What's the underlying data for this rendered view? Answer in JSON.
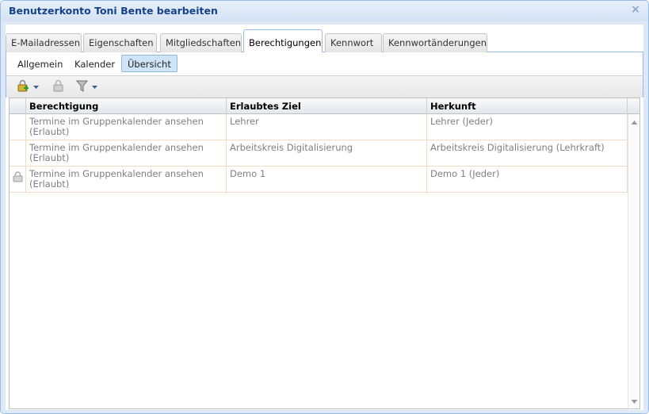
{
  "window": {
    "title": "Benutzerkonto Toni Bente bearbeiten",
    "close_glyph": "×"
  },
  "tabs": [
    {
      "label": "E-Mailadressen",
      "active": false
    },
    {
      "label": "Eigenschaften",
      "active": false
    },
    {
      "label": "Mitgliedschaften",
      "active": false
    },
    {
      "label": "Berechtigungen",
      "active": true
    },
    {
      "label": "Kennwort",
      "active": false
    },
    {
      "label": "Kennwortänderungen",
      "active": false
    }
  ],
  "subtabs": [
    {
      "label": "Allgemein",
      "active": false
    },
    {
      "label": "Kalender",
      "active": false
    },
    {
      "label": "Übersicht",
      "active": true
    }
  ],
  "toolbar": {
    "buttons": [
      {
        "icon": "add-permission-icon",
        "has_dropdown": true,
        "enabled": true
      },
      {
        "icon": "remove-permission-icon",
        "has_dropdown": false,
        "enabled": false
      },
      {
        "icon": "filter-icon",
        "has_dropdown": true,
        "enabled": true
      }
    ]
  },
  "grid": {
    "columns": [
      "Berechtigung",
      "Erlaubtes Ziel",
      "Herkunft"
    ],
    "rows": [
      {
        "locked": false,
        "berechtigung_line1": "Termine im Gruppenkalender ansehen",
        "berechtigung_line2": "(Erlaubt)",
        "ziel": "Lehrer",
        "herkunft": "Lehrer (Jeder)"
      },
      {
        "locked": false,
        "berechtigung_line1": "Termine im Gruppenkalender ansehen",
        "berechtigung_line2": "(Erlaubt)",
        "ziel": "Arbeitskreis Digitalisierung",
        "herkunft": "Arbeitskreis Digitalisierung (Lehrkraft)"
      },
      {
        "locked": true,
        "berechtigung_line1": "Termine im Gruppenkalender ansehen",
        "berechtigung_line2": "(Erlaubt)",
        "ziel": "Demo 1",
        "herkunft": "Demo 1 (Jeder)"
      }
    ]
  },
  "colors": {
    "title": "#15428b",
    "border": "#99bbe8",
    "active_subtab_bg": "#cfe4f7",
    "row_separator": "#f0dcc0",
    "cell_text": "#808080"
  }
}
